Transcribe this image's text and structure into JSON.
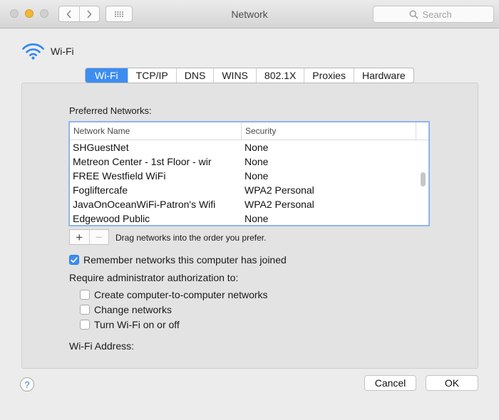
{
  "window": {
    "title": "Network"
  },
  "search": {
    "placeholder": "Search"
  },
  "header": {
    "title": "Wi-Fi"
  },
  "tabs": [
    {
      "label": "Wi-Fi",
      "active": true
    },
    {
      "label": "TCP/IP"
    },
    {
      "label": "DNS"
    },
    {
      "label": "WINS"
    },
    {
      "label": "802.1X"
    },
    {
      "label": "Proxies"
    },
    {
      "label": "Hardware"
    }
  ],
  "preferred": {
    "label": "Preferred Networks:",
    "columns": {
      "name": "Network Name",
      "security": "Security"
    },
    "rows": [
      {
        "name": "SHGuestNet",
        "security": "None"
      },
      {
        "name": "Metreon Center - 1st Floor - wir",
        "security": "None"
      },
      {
        "name": "FREE Westfield WiFi",
        "security": "None"
      },
      {
        "name": "Fogliftercafe",
        "security": "WPA2 Personal"
      },
      {
        "name": "JavaOnOceanWiFi-Patron's Wifi",
        "security": "WPA2 Personal"
      },
      {
        "name": "Edgewood Public",
        "security": "None"
      }
    ],
    "drag_hint": "Drag networks into the order you prefer."
  },
  "options": {
    "remember": {
      "label": "Remember networks this computer has joined",
      "checked": true
    },
    "admin_label": "Require administrator authorization to:",
    "admin_items": [
      {
        "label": "Create computer-to-computer networks",
        "checked": false
      },
      {
        "label": "Change networks",
        "checked": false
      },
      {
        "label": "Turn Wi-Fi on or off",
        "checked": false
      }
    ],
    "address_label": "Wi-Fi Address:"
  },
  "buttons": {
    "help": "?",
    "cancel": "Cancel",
    "ok": "OK",
    "add": "+",
    "remove": "−"
  },
  "colors": {
    "accent": "#3d8df0",
    "minimize_light": "#f4b637",
    "wifi_icon": "#2f86f5"
  }
}
